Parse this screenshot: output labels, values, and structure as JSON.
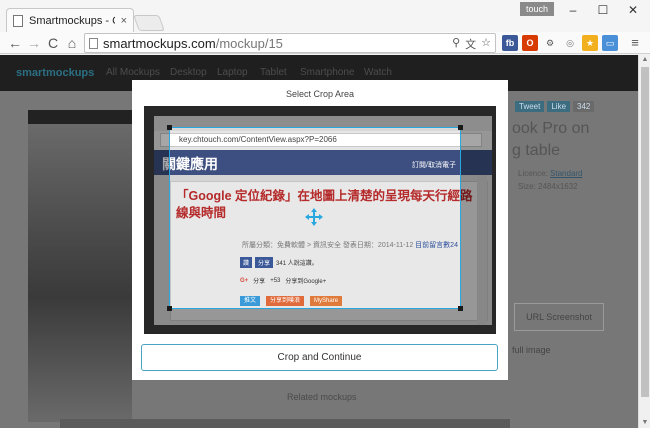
{
  "browser": {
    "tab_title": "Smartmockups - Create",
    "tab_close": "×",
    "profile_label": "touch",
    "window_controls": {
      "minimize": "–",
      "maximize": "☐",
      "close": "✕"
    },
    "nav": {
      "back": "←",
      "forward": "→",
      "reload": "C",
      "home": "⌂"
    },
    "url_host": "smartmockups.com",
    "url_path": "/mockup/15",
    "extensions": [
      {
        "name": "fb",
        "label": "fb",
        "color": "#3b5998"
      },
      {
        "name": "office",
        "label": "O",
        "color": "#d83b01"
      },
      {
        "name": "gear",
        "label": "⚙",
        "color": "#888888"
      },
      {
        "name": "compass",
        "label": "◎",
        "color": "#9a9a9a"
      },
      {
        "name": "star",
        "label": "★",
        "color": "#f2b01e"
      },
      {
        "name": "cast",
        "label": "▭",
        "color": "#4a90d9"
      }
    ],
    "menu": "≡"
  },
  "page_background": {
    "logo": "smartmockups",
    "nav_items": [
      "All Mockups",
      "Desktop",
      "Laptop",
      "Tablet",
      "Smartphone",
      "Watch"
    ],
    "shares": [
      "Tweet",
      "Like",
      "342"
    ],
    "title_line1": "ook Pro on",
    "title_line2": "g table",
    "licence_label": "Licence:",
    "licence_value": "Standard",
    "size_label": "Size:",
    "size_value": "2484x1632",
    "url_screenshot": "URL Screenshot",
    "full_image": "full image",
    "related": "Related mockups"
  },
  "modal": {
    "title": "Select Crop Area",
    "crop_button": "Crop and Continue"
  },
  "inner_screenshot": {
    "url": "key.chtouch.com/ContentView.aspx?P=2066",
    "site_title": "關鍵應用",
    "site_menu": "訂閱/取消電子",
    "headline": "「Google 定位紀錄」在地圖上清楚的呈現每天行經路線與時間",
    "meta": "所屬分類：免費軟體 > 資訊安全   發表日期：2014-11-12",
    "meta_link": "目前留言數24",
    "social": {
      "fb_like": "讚",
      "fb_share": "分享",
      "likes": "341 人說這讚。"
    },
    "gplus": {
      "label": "分享",
      "count": "+53",
      "note": "分享到Google+"
    },
    "share_chips": [
      {
        "label": "推文",
        "color": "#3b9bd9"
      },
      {
        "label": "分享到噗浪",
        "color": "#e06a3a"
      },
      {
        "label": "MyShare",
        "color": "#e07a3a"
      }
    ]
  }
}
